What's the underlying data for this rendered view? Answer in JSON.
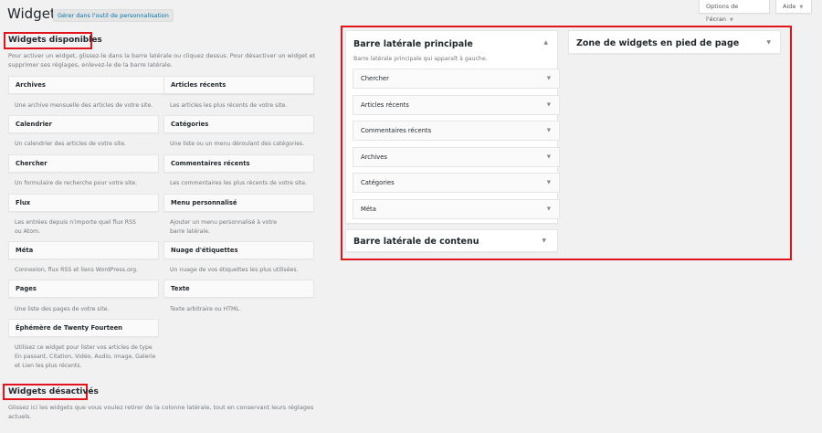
{
  "header": {
    "title": "Widgets",
    "customize_button": "Gérer dans l'outil de personnalisation",
    "screen_options": "Options de l'écran",
    "help": "Aide"
  },
  "available": {
    "heading": "Widgets disponibles",
    "description": "Pour activer un widget, glissez-le dans la barre latérale ou cliquez dessus. Pour désactiver un widget et supprimer ses réglages, enlevez-le de la barre latérale.",
    "widgets": [
      {
        "name": "Archives",
        "desc": "Une archive mensuelle des articles de votre site."
      },
      {
        "name": "Articles récents",
        "desc": "Les articles les plus récents de votre site."
      },
      {
        "name": "Calendrier",
        "desc": "Un calendrier des articles de votre site."
      },
      {
        "name": "Catégories",
        "desc": "Une liste ou un menu déroulant des catégories."
      },
      {
        "name": "Chercher",
        "desc": "Un formulaire de recherche pour votre site."
      },
      {
        "name": "Commentaires récents",
        "desc": "Les commentaires les plus récents de votre site."
      },
      {
        "name": "Flux",
        "desc": "Les entrées depuis n'importe quel flux RSS ou Atom."
      },
      {
        "name": "Menu personnalisé",
        "desc": "Ajouter un menu personnalisé à votre barre latérale."
      },
      {
        "name": "Méta",
        "desc": "Connexion, flux RSS et liens WordPress.org."
      },
      {
        "name": "Nuage d'étiquettes",
        "desc": "Un nuage de vos étiquettes les plus utilisées."
      },
      {
        "name": "Pages",
        "desc": "Une liste des pages de votre site."
      },
      {
        "name": "Texte",
        "desc": "Texte arbitraire ou HTML."
      },
      {
        "name": "Éphémère de Twenty Fourteen",
        "desc": "Utilisez ce widget pour lister vos articles de type En passant, Citation, Vidéo, Audio, Image, Galerie et Lien les plus récents."
      }
    ]
  },
  "inactive": {
    "heading": "Widgets désactivés",
    "description": "Glissez ici les widgets que vous voulez retirer de la colonne latérale, tout en conservant leurs réglages actuels."
  },
  "sidebars": {
    "main": {
      "title": "Barre latérale principale",
      "description": "Barre latérale principale qui apparaît à gauche.",
      "widgets": [
        "Chercher",
        "Articles récents",
        "Commentaires récents",
        "Archives",
        "Catégories",
        "Méta"
      ]
    },
    "content": {
      "title": "Barre latérale de contenu"
    },
    "footer": {
      "title": "Zone de widgets en pied de page"
    }
  },
  "colors": {
    "highlight": "#e0141b",
    "link": "#0073aa"
  },
  "icons": {
    "expand": "caret-down-icon",
    "collapse": "caret-up-icon"
  }
}
